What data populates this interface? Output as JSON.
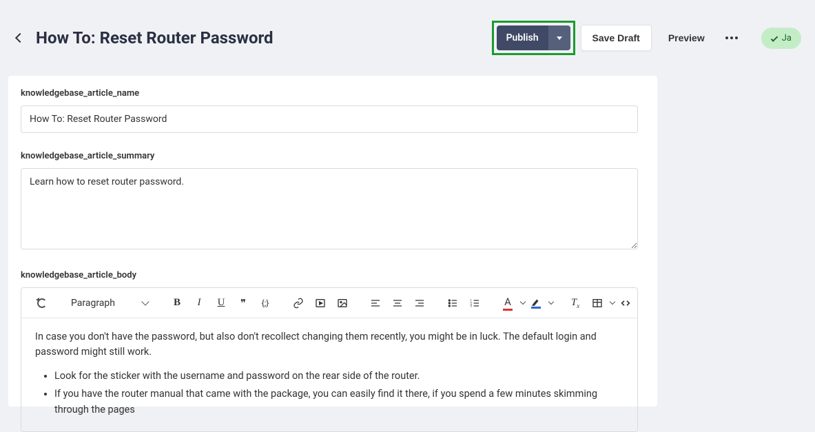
{
  "header": {
    "title": "How To: Reset Router Password",
    "publish_label": "Publish",
    "save_draft_label": "Save Draft",
    "preview_label": "Preview",
    "status_text": "Ja"
  },
  "fields": {
    "name": {
      "label": "knowledgebase_article_name",
      "value": "How To: Reset Router Password"
    },
    "summary": {
      "label": "knowledgebase_article_summary",
      "value": "Learn how to reset router password."
    },
    "body": {
      "label": "knowledgebase_article_body"
    }
  },
  "rte": {
    "style_select": "Paragraph",
    "para1": "In case you don't have the password, but also don't recollect changing them recently, you might be in luck. The default login and password might still work.",
    "bullet1": "Look for the sticker with the username and password on the rear side of the router.",
    "bullet2": "If you have the router manual that came with the package, you can easily find it there, if you spend a few minutes skimming through the pages"
  },
  "icons": {
    "quote": "❞",
    "code_braces": "{;}",
    "font_letter": "A",
    "highlight_letter": "",
    "clear_format": "Tx",
    "embed_code": "< >"
  }
}
